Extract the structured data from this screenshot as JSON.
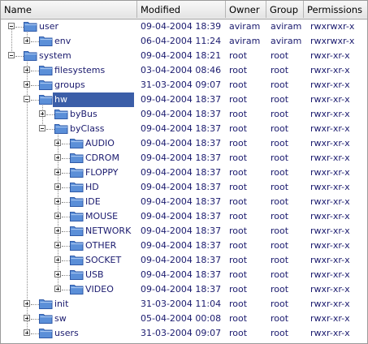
{
  "columns": {
    "name": "Name",
    "modified": "Modified",
    "owner": "Owner",
    "group": "Group",
    "permissions": "Permissions"
  },
  "rows": [
    {
      "name": "user",
      "depth": 0,
      "expander": "minus",
      "modified": "09-04-2004 18:39",
      "owner": "aviram",
      "group": "aviram",
      "permissions": "rwxrwxr-x"
    },
    {
      "name": "env",
      "depth": 1,
      "expander": "plus",
      "modified": "06-04-2004 11:24",
      "owner": "aviram",
      "group": "aviram",
      "permissions": "rwxrwxr-x"
    },
    {
      "name": "system",
      "depth": 0,
      "expander": "minus",
      "modified": "09-04-2004 18:21",
      "owner": "root",
      "group": "root",
      "permissions": "rwxr-xr-x"
    },
    {
      "name": "filesystems",
      "depth": 1,
      "expander": "plus",
      "modified": "03-04-2004 08:46",
      "owner": "root",
      "group": "root",
      "permissions": "rwxr-xr-x"
    },
    {
      "name": "groups",
      "depth": 1,
      "expander": "plus",
      "modified": "31-03-2004 09:07",
      "owner": "root",
      "group": "root",
      "permissions": "rwxr-xr-x"
    },
    {
      "name": "hw",
      "depth": 1,
      "expander": "minus",
      "selected": true,
      "modified": "09-04-2004 18:37",
      "owner": "root",
      "group": "root",
      "permissions": "rwxr-xr-x"
    },
    {
      "name": "byBus",
      "depth": 2,
      "expander": "plus",
      "modified": "09-04-2004 18:37",
      "owner": "root",
      "group": "root",
      "permissions": "rwxr-xr-x"
    },
    {
      "name": "byClass",
      "depth": 2,
      "expander": "minus",
      "modified": "09-04-2004 18:37",
      "owner": "root",
      "group": "root",
      "permissions": "rwxr-xr-x"
    },
    {
      "name": "AUDIO",
      "depth": 3,
      "expander": "plus",
      "modified": "09-04-2004 18:37",
      "owner": "root",
      "group": "root",
      "permissions": "rwxr-xr-x"
    },
    {
      "name": "CDROM",
      "depth": 3,
      "expander": "plus",
      "modified": "09-04-2004 18:37",
      "owner": "root",
      "group": "root",
      "permissions": "rwxr-xr-x"
    },
    {
      "name": "FLOPPY",
      "depth": 3,
      "expander": "plus",
      "modified": "09-04-2004 18:37",
      "owner": "root",
      "group": "root",
      "permissions": "rwxr-xr-x"
    },
    {
      "name": "HD",
      "depth": 3,
      "expander": "plus",
      "modified": "09-04-2004 18:37",
      "owner": "root",
      "group": "root",
      "permissions": "rwxr-xr-x"
    },
    {
      "name": "IDE",
      "depth": 3,
      "expander": "plus",
      "modified": "09-04-2004 18:37",
      "owner": "root",
      "group": "root",
      "permissions": "rwxr-xr-x"
    },
    {
      "name": "MOUSE",
      "depth": 3,
      "expander": "plus",
      "modified": "09-04-2004 18:37",
      "owner": "root",
      "group": "root",
      "permissions": "rwxr-xr-x"
    },
    {
      "name": "NETWORK",
      "depth": 3,
      "expander": "plus",
      "modified": "09-04-2004 18:37",
      "owner": "root",
      "group": "root",
      "permissions": "rwxr-xr-x"
    },
    {
      "name": "OTHER",
      "depth": 3,
      "expander": "plus",
      "modified": "09-04-2004 18:37",
      "owner": "root",
      "group": "root",
      "permissions": "rwxr-xr-x"
    },
    {
      "name": "SOCKET",
      "depth": 3,
      "expander": "plus",
      "modified": "09-04-2004 18:37",
      "owner": "root",
      "group": "root",
      "permissions": "rwxr-xr-x"
    },
    {
      "name": "USB",
      "depth": 3,
      "expander": "plus",
      "modified": "09-04-2004 18:37",
      "owner": "root",
      "group": "root",
      "permissions": "rwxr-xr-x"
    },
    {
      "name": "VIDEO",
      "depth": 3,
      "expander": "plus",
      "modified": "09-04-2004 18:37",
      "owner": "root",
      "group": "root",
      "permissions": "rwxr-xr-x"
    },
    {
      "name": "init",
      "depth": 1,
      "expander": "plus",
      "modified": "31-03-2004 11:04",
      "owner": "root",
      "group": "root",
      "permissions": "rwxr-xr-x"
    },
    {
      "name": "sw",
      "depth": 1,
      "expander": "plus",
      "modified": "05-04-2004 00:08",
      "owner": "root",
      "group": "root",
      "permissions": "rwxr-xr-x"
    },
    {
      "name": "users",
      "depth": 1,
      "expander": "plus",
      "modified": "31-03-2004 09:07",
      "owner": "root",
      "group": "root",
      "permissions": "rwxr-xr-x"
    }
  ],
  "colors": {
    "folder_fill": "#5b8fd8",
    "folder_dark": "#2f5aa8",
    "folder_light": "#a9c8f2",
    "selection": "#3b5ea8",
    "text": "#1a1a6e"
  },
  "icons": {
    "folder": "folder-icon",
    "expand": "expand-plus-icon",
    "collapse": "collapse-minus-icon"
  }
}
